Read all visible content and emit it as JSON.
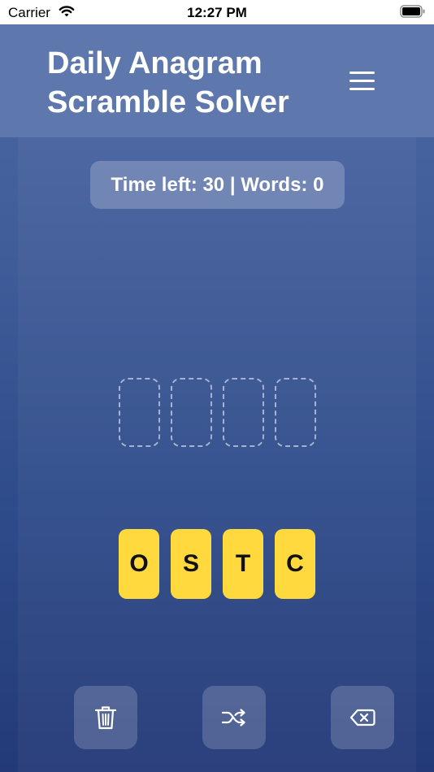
{
  "status_bar": {
    "carrier": "Carrier",
    "time": "12:27 PM"
  },
  "header": {
    "title_line1": "Daily Anagram",
    "title_line2": "Scramble Solver",
    "menu_icon": "hamburger-menu-icon"
  },
  "game": {
    "status_text": "Time left: 30 | Words: 0",
    "answer_slots": [
      "",
      "",
      "",
      ""
    ],
    "letters": [
      "O",
      "S",
      "T",
      "C"
    ],
    "tile_color": "#ffd93d"
  },
  "actions": {
    "clear_icon": "trash-icon",
    "shuffle_icon": "shuffle-icon",
    "backspace_icon": "backspace-icon"
  }
}
